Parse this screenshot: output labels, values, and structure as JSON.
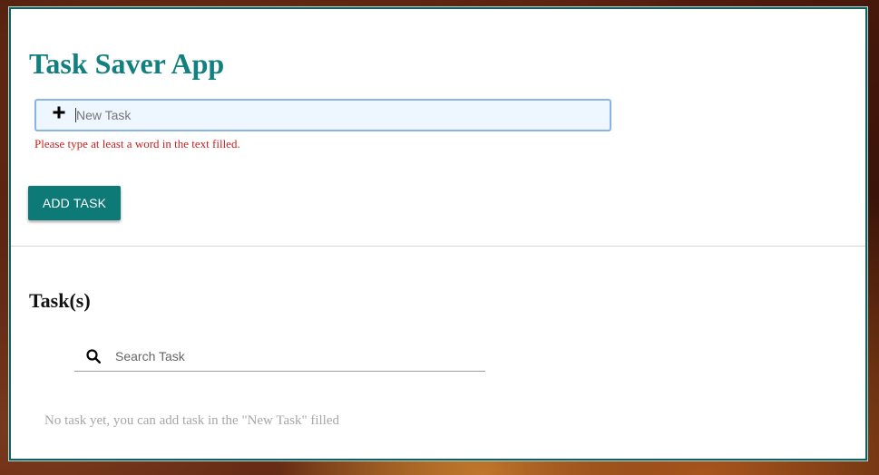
{
  "app": {
    "title": "Task Saver App"
  },
  "new_task": {
    "placeholder": "New Task",
    "value": "",
    "icon": "plus-icon",
    "error": "Please type at least a word in the text filled."
  },
  "actions": {
    "add_label": "ADD TASK"
  },
  "tasks_section": {
    "heading": "Task(s)",
    "search": {
      "placeholder": "Search Task",
      "value": "",
      "icon": "search-icon"
    },
    "empty_message": "No task yet, you can add task in the \"New Task\" filled",
    "items": []
  },
  "colors": {
    "accent": "#128080",
    "button": "#0d7a78",
    "error": "#cc1f1f",
    "input_bg": "#eef6ff",
    "input_border": "#8ab4e8",
    "muted": "#a7a7a7"
  }
}
